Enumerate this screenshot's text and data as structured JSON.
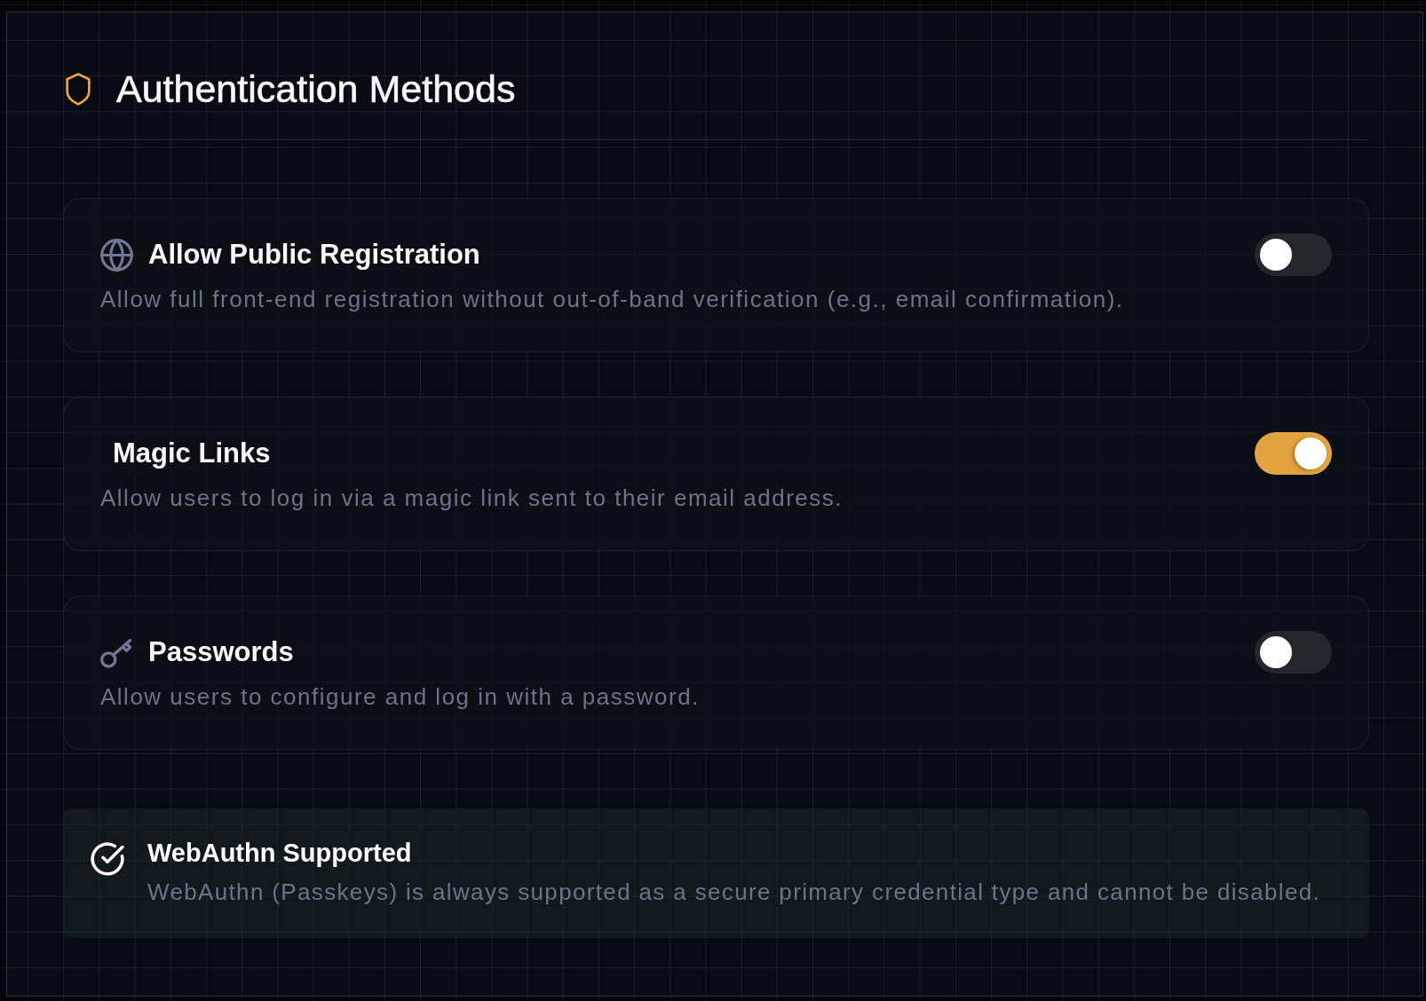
{
  "section": {
    "title": "Authentication Methods"
  },
  "methods": [
    {
      "title": "Allow Public Registration",
      "description": "Allow full front-end registration without out-of-band verification (e.g., email confirmation).",
      "on": false
    },
    {
      "title": "Magic Links",
      "description": "Allow users to log in via a magic link sent to their email address.",
      "on": true
    },
    {
      "title": "Passwords",
      "description": "Allow users to configure and log in with a password.",
      "on": false
    }
  ],
  "notice": {
    "title": "WebAuthn Supported",
    "description": "WebAuthn (Passkeys) is always supported as a secure primary credential type and cannot be disabled."
  }
}
